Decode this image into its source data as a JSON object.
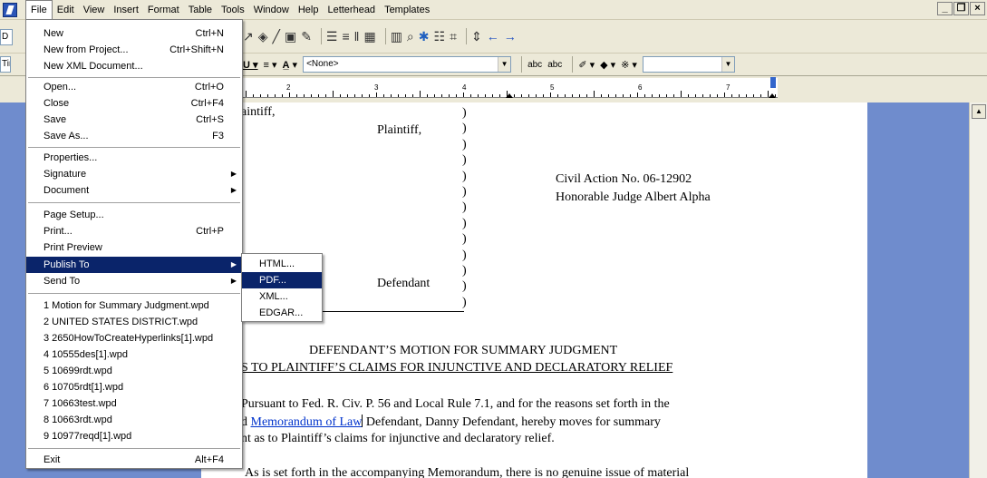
{
  "menubar": {
    "items": [
      "File",
      "Edit",
      "View",
      "Insert",
      "Format",
      "Table",
      "Tools",
      "Window",
      "Help",
      "Letterhead",
      "Templates"
    ],
    "window_controls": [
      "_",
      "Б",
      "×"
    ]
  },
  "toolbar": {
    "left_stub_top": "D",
    "left_stub_font": "Tim",
    "style_select": "<None>",
    "fill_select": ""
  },
  "ruler": {
    "numbers": [
      "2",
      "3",
      "4",
      "5",
      "6",
      "7"
    ]
  },
  "file_menu": {
    "items": [
      {
        "label": "New",
        "shortcut": "Ctrl+N"
      },
      {
        "label": "New from Project...",
        "shortcut": "Ctrl+Shift+N"
      },
      {
        "label": "New XML Document...",
        "shortcut": ""
      },
      {
        "label": "Open...",
        "shortcut": "Ctrl+O"
      },
      {
        "label": "Close",
        "shortcut": "Ctrl+F4"
      },
      {
        "label": "Save",
        "shortcut": "Ctrl+S"
      },
      {
        "label": "Save As...",
        "shortcut": "F3"
      },
      {
        "label": "Properties...",
        "shortcut": ""
      },
      {
        "label": "Signature",
        "shortcut": ""
      },
      {
        "label": "Document",
        "shortcut": ""
      },
      {
        "label": "Page Setup...",
        "shortcut": ""
      },
      {
        "label": "Print...",
        "shortcut": "Ctrl+P"
      },
      {
        "label": "Print Preview",
        "shortcut": ""
      },
      {
        "label": "Publish To",
        "shortcut": ""
      },
      {
        "label": "Send To",
        "shortcut": ""
      },
      {
        "label": "1 Motion for Summary Judgment.wpd",
        "shortcut": ""
      },
      {
        "label": "2 UNITED STATES DISTRICT.wpd",
        "shortcut": ""
      },
      {
        "label": "3 2650HowToCreateHyperlinks[1].wpd",
        "shortcut": ""
      },
      {
        "label": "4 10555des[1].wpd",
        "shortcut": ""
      },
      {
        "label": "5 10699rdt.wpd",
        "shortcut": ""
      },
      {
        "label": "6 10705rdt[1].wpd",
        "shortcut": ""
      },
      {
        "label": "7 10663test.wpd",
        "shortcut": ""
      },
      {
        "label": "8 10663rdt.wpd",
        "shortcut": ""
      },
      {
        "label": "9 10977reqd[1].wpd",
        "shortcut": ""
      },
      {
        "label": "Exit",
        "shortcut": "Alt+F4"
      }
    ]
  },
  "publish_submenu": {
    "items": [
      "HTML...",
      "PDF...",
      "XML...",
      "EDGAR..."
    ],
    "selected": "PDF..."
  },
  "document": {
    "caption_left_1": "aintiff,",
    "caption_plaintiff": "Plaintiff,",
    "caption_defendant": "Defendant",
    "civil_action": "Civil Action No. 06-12902",
    "judge": "Honorable Judge Albert Alpha",
    "title_line1": "DEFENDANT’S MOTION FOR SUMMARY JUDGMENT",
    "title_line2": "S TO PLAINTIFF’S CLAIMS FOR INJUNCTIVE AND DECLARATORY RELIEF",
    "para1_line1": "Pursuant to Fed. R. Civ. P. 56 and Local Rule 7.1, and for the reasons set forth in the",
    "para1_line2_prefix": "d ",
    "para1_link": "Memorandum of Law",
    "para1_line2_suffix": " Defendant, Danny Defendant, hereby moves for summary",
    "para1_line3": "nt as to Plaintiff’s claims for injunctive and declaratory relief.",
    "para2_line1": "As is set forth in the accompanying Memorandum, there is no genuine issue of material"
  }
}
